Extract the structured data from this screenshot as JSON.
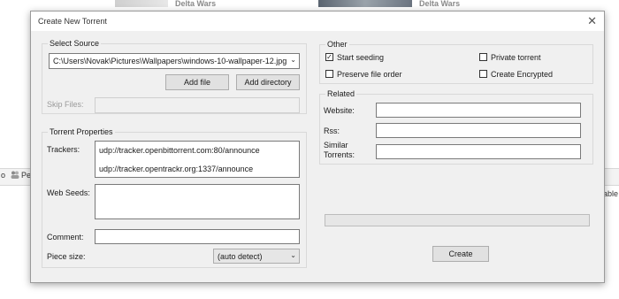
{
  "background": {
    "thumb_title_1": "Delta Wars",
    "thumb_title_2": "Delta Wars",
    "cut_text_left": "o",
    "cut_text_left2": "Pe",
    "cut_text_right": "able"
  },
  "dialog": {
    "title": "Create New Torrent",
    "close_glyph": "✕"
  },
  "source": {
    "legend": "Select Source",
    "path": "C:\\Users\\Novak\\Pictures\\Wallpapers\\windows-10-wallpaper-12.jpg",
    "add_file": "Add file",
    "add_directory": "Add directory",
    "skip_files_label": "Skip Files:"
  },
  "properties": {
    "legend": "Torrent Properties",
    "trackers_label": "Trackers:",
    "trackers": [
      "udp://tracker.openbittorrent.com:80/announce",
      "udp://tracker.opentrackr.org:1337/announce"
    ],
    "web_seeds_label": "Web Seeds:",
    "comment_label": "Comment:",
    "comment_value": "",
    "piece_size_label": "Piece size:",
    "piece_size_value": "(auto detect)"
  },
  "other": {
    "legend": "Other",
    "start_seeding": {
      "label": "Start seeding",
      "checked": true
    },
    "private_torrent": {
      "label": "Private torrent",
      "checked": false
    },
    "preserve_file_order": {
      "label": "Preserve file order",
      "checked": false
    },
    "create_encrypted": {
      "label": "Create Encrypted",
      "checked": false
    }
  },
  "related": {
    "legend": "Related",
    "website_label": "Website:",
    "rss_label": "Rss:",
    "similar_label_1": "Similar",
    "similar_label_2": "Torrents:"
  },
  "progress": 0,
  "create_button": "Create",
  "check_glyph": "✓",
  "dropdown_glyph": "⌄"
}
